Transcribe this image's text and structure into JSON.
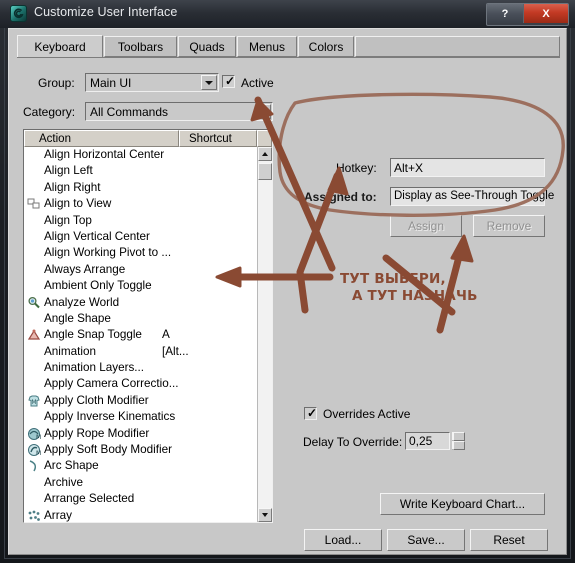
{
  "window": {
    "title": "Customize User Interface",
    "icon": "max-logo-icon",
    "buttons": [
      {
        "name": "help-button",
        "label": "?"
      },
      {
        "name": "close-button",
        "label": "X"
      }
    ]
  },
  "tabs": [
    {
      "label": "Keyboard",
      "active": true
    },
    {
      "label": "Toolbars",
      "active": false
    },
    {
      "label": "Quads",
      "active": false
    },
    {
      "label": "Menus",
      "active": false
    },
    {
      "label": "Colors",
      "active": false
    }
  ],
  "form": {
    "group_label": "Group:",
    "group_value": "Main UI",
    "active_label": "Active",
    "active_checked": true,
    "category_label": "Category:",
    "category_value": "All Commands"
  },
  "list": {
    "columns": [
      "Action",
      "Shortcut"
    ],
    "rows": [
      {
        "icon": "",
        "name": "Align Horizontal Center",
        "shortcut": ""
      },
      {
        "icon": "",
        "name": "Align Left",
        "shortcut": ""
      },
      {
        "icon": "",
        "name": "Align Right",
        "shortcut": ""
      },
      {
        "icon": "align-to-view-icon",
        "name": "Align to View",
        "shortcut": ""
      },
      {
        "icon": "",
        "name": "Align Top",
        "shortcut": ""
      },
      {
        "icon": "",
        "name": "Align Vertical Center",
        "shortcut": ""
      },
      {
        "icon": "",
        "name": "Align Working Pivot to ...",
        "shortcut": ""
      },
      {
        "icon": "",
        "name": "Always Arrange",
        "shortcut": ""
      },
      {
        "icon": "",
        "name": "Ambient Only Toggle",
        "shortcut": ""
      },
      {
        "icon": "analyze-world-icon",
        "name": "Analyze World",
        "shortcut": ""
      },
      {
        "icon": "",
        "name": "Angle Shape",
        "shortcut": ""
      },
      {
        "icon": "angle-snap-icon",
        "name": "Angle Snap Toggle",
        "shortcut": "A"
      },
      {
        "icon": "",
        "name": "Animation",
        "shortcut": "[Alt..."
      },
      {
        "icon": "",
        "name": "Animation Layers...",
        "shortcut": ""
      },
      {
        "icon": "",
        "name": "Apply Camera Correctio...",
        "shortcut": ""
      },
      {
        "icon": "cloth-modifier-icon",
        "name": "Apply Cloth Modifier",
        "shortcut": ""
      },
      {
        "icon": "",
        "name": "Apply Inverse Kinematics",
        "shortcut": ""
      },
      {
        "icon": "rope-modifier-icon",
        "name": "Apply Rope Modifier",
        "shortcut": ""
      },
      {
        "icon": "soft-body-modifier-icon",
        "name": "Apply Soft Body Modifier",
        "shortcut": ""
      },
      {
        "icon": "arc-shape-icon",
        "name": "Arc Shape",
        "shortcut": ""
      },
      {
        "icon": "",
        "name": "Archive",
        "shortcut": ""
      },
      {
        "icon": "",
        "name": "Arrange Selected",
        "shortcut": ""
      },
      {
        "icon": "array-icon",
        "name": "Array",
        "shortcut": ""
      }
    ]
  },
  "hotkey_panel": {
    "hotkey_label": "Hotkey:",
    "hotkey_value": "Alt+X",
    "assigned_label": "Assigned to:",
    "assigned_value": "Display as See-Through Toggle",
    "assign_button": "Assign",
    "remove_button": "Remove"
  },
  "overrides": {
    "overrides_label": "Overrides Active",
    "overrides_checked": true,
    "delay_label": "Delay To Override:",
    "delay_value": "0,25"
  },
  "actions": {
    "write_chart": "Write Keyboard Chart...",
    "load": "Load...",
    "save": "Save...",
    "reset": "Reset"
  },
  "annotations": {
    "line1": "ТУТ ВЫБЕРИ,",
    "line2": "А ТУТ НАЗНАЧЬ",
    "ink_color": "#8a4a33"
  }
}
